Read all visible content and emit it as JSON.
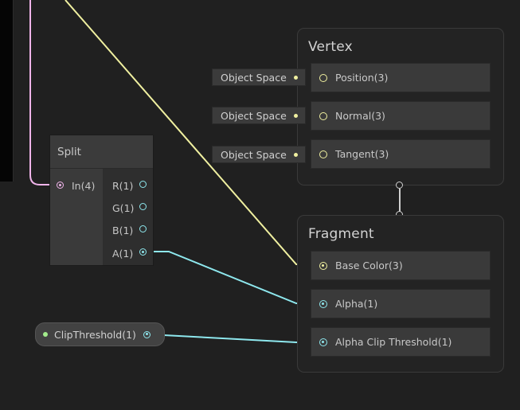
{
  "vertex": {
    "title": "Vertex",
    "slots": [
      {
        "label": "Position(3)",
        "input": "Object Space"
      },
      {
        "label": "Normal(3)",
        "input": "Object Space"
      },
      {
        "label": "Tangent(3)",
        "input": "Object Space"
      }
    ]
  },
  "fragment": {
    "title": "Fragment",
    "slots": [
      {
        "label": "Base Color(3)"
      },
      {
        "label": "Alpha(1)"
      },
      {
        "label": "Alpha Clip Threshold(1)"
      }
    ]
  },
  "split": {
    "title": "Split",
    "input": "In(4)",
    "outputs": [
      "R(1)",
      "G(1)",
      "B(1)",
      "A(1)"
    ]
  },
  "property": {
    "label": "ClipThreshold(1)"
  },
  "colors": {
    "vector3_port": "#f0f0a0",
    "float_port": "#8ee8ee",
    "vector4_port": "#f0b4ea",
    "property_dot": "#a3ec8c",
    "background": "#202020"
  }
}
